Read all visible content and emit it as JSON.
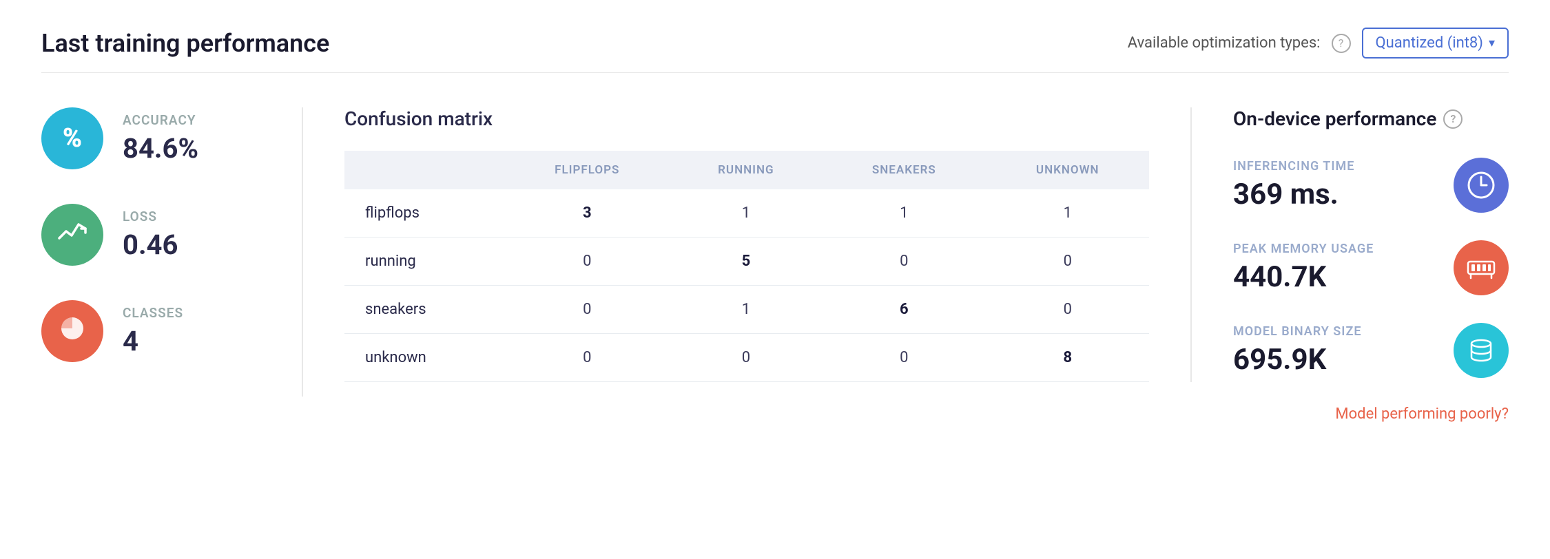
{
  "header": {
    "title": "Last training performance",
    "optimization_label": "Available optimization types:",
    "help_icon": "?",
    "dropdown_label": "Quantized (int8)",
    "dropdown_arrow": "▾"
  },
  "stats": [
    {
      "id": "accuracy",
      "label": "ACCURACY",
      "value": "84.6%",
      "icon_type": "blue",
      "icon_symbol": "%"
    },
    {
      "id": "loss",
      "label": "LOSS",
      "value": "0.46",
      "icon_type": "green",
      "icon_symbol": "📉"
    },
    {
      "id": "classes",
      "label": "CLASSES",
      "value": "4",
      "icon_type": "orange",
      "icon_symbol": "pie"
    }
  ],
  "confusion_matrix": {
    "title": "Confusion matrix",
    "columns": [
      "",
      "FLIPFLOPS",
      "RUNNING",
      "SNEAKERS",
      "UNKNOWN"
    ],
    "rows": [
      {
        "label": "flipflops",
        "values": [
          3,
          1,
          1,
          1
        ]
      },
      {
        "label": "running",
        "values": [
          0,
          5,
          0,
          0
        ]
      },
      {
        "label": "sneakers",
        "values": [
          0,
          1,
          6,
          0
        ]
      },
      {
        "label": "unknown",
        "values": [
          0,
          0,
          0,
          8
        ]
      }
    ]
  },
  "performance": {
    "title": "On-device performance",
    "help_icon": "?",
    "items": [
      {
        "id": "inferencing_time",
        "label": "INFERENCING TIME",
        "value": "369 ms.",
        "icon_type": "purple"
      },
      {
        "id": "peak_memory",
        "label": "PEAK MEMORY USAGE",
        "value": "440.7K",
        "icon_type": "red"
      },
      {
        "id": "model_binary",
        "label": "MODEL BINARY SIZE",
        "value": "695.9K",
        "icon_type": "cyan"
      }
    ],
    "poorly_link": "Model performing poorly?"
  }
}
